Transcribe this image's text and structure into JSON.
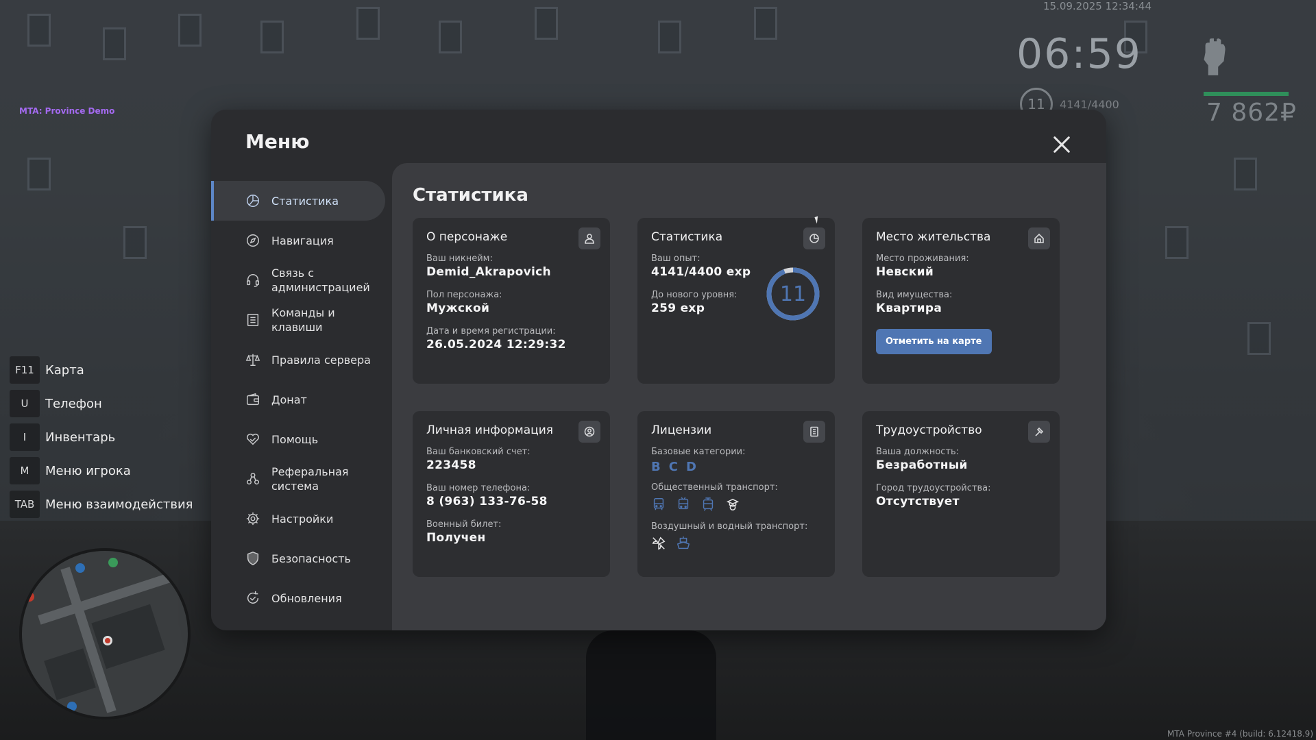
{
  "hud": {
    "datetime": "15.09.2025 12:34:44",
    "clock": "06:59",
    "level": "11",
    "exp": "4141/4400",
    "money": "7 862₽",
    "server_label": "MTA: Province Demo",
    "build": "MTA Province #4 (build: 6.12418.9)"
  },
  "hotkeys": [
    {
      "key": "F11",
      "label": "Карта"
    },
    {
      "key": "U",
      "label": "Телефон"
    },
    {
      "key": "I",
      "label": "Инвентарь"
    },
    {
      "key": "M",
      "label": "Меню игрока"
    },
    {
      "key": "TAB",
      "label": "Меню взаимодействия"
    }
  ],
  "modal": {
    "title": "Меню",
    "close_icon": "close-icon"
  },
  "sidebar": {
    "items": [
      {
        "label": "Статистика",
        "icon": "pie-chart-icon",
        "active": true
      },
      {
        "label": "Навигация",
        "icon": "compass-icon"
      },
      {
        "label": "Связь с\nадминистрацией",
        "icon": "headset-icon"
      },
      {
        "label": "Команды и\nклавиши",
        "icon": "list-icon"
      },
      {
        "label": "Правила сервера",
        "icon": "scales-icon"
      },
      {
        "label": "Донат",
        "icon": "wallet-icon"
      },
      {
        "label": "Помощь",
        "icon": "handshake-icon"
      },
      {
        "label": "Реферальная\nсистема",
        "icon": "referral-icon"
      },
      {
        "label": "Настройки",
        "icon": "gear-icon"
      },
      {
        "label": "Безопасность",
        "icon": "shield-icon"
      },
      {
        "label": "Обновления",
        "icon": "refresh-icon"
      }
    ]
  },
  "content": {
    "title": "Статистика",
    "character": {
      "title": "О персонаже",
      "icon": "user-icon",
      "nickname_label": "Ваш никнейм:",
      "nickname": "Demid_Akrapovich",
      "gender_label": "Пол персонажа:",
      "gender": "Мужской",
      "reg_label": "Дата и время регистрации:",
      "reg": "26.05.2024 12:29:32"
    },
    "stats": {
      "title": "Статистика",
      "icon": "chart-icon",
      "exp_label": "Ваш опыт:",
      "exp": "4141/4400 exp",
      "next_label": "До нового уровня:",
      "next": "259 exp",
      "level": "11",
      "level_progress": 0.941
    },
    "residence": {
      "title": "Место жительства",
      "icon": "house-icon",
      "place_label": "Место проживания:",
      "place": "Невский",
      "property_label": "Вид имущества:",
      "property": "Квартира",
      "button": "Отметить на карте"
    },
    "personal": {
      "title": "Личная информация",
      "icon": "user-circle-icon",
      "bank_label": "Ваш банковский счет:",
      "bank": "223458",
      "phone_label": "Ваш номер телефона:",
      "phone": "8 (963) 133-76-58",
      "military_label": "Военный билет:",
      "military": "Получен"
    },
    "licenses": {
      "title": "Лицензии",
      "icon": "license-icon",
      "base_label": "Базовые категории:",
      "base": [
        "B",
        "C",
        "D"
      ],
      "public_label": "Общественный транспорт:",
      "air_label": "Воздушный и водный транспорт:"
    },
    "job": {
      "title": "Трудоустройство",
      "icon": "hammer-icon",
      "position_label": "Ваша должность:",
      "position": "Безработный",
      "city_label": "Город трудоустройства:",
      "city": "Отсутствует"
    }
  },
  "colors": {
    "accent": "#4f76b3",
    "panel": "#2b2c2f",
    "content": "#3b3c40",
    "card": "#2d2e31"
  }
}
